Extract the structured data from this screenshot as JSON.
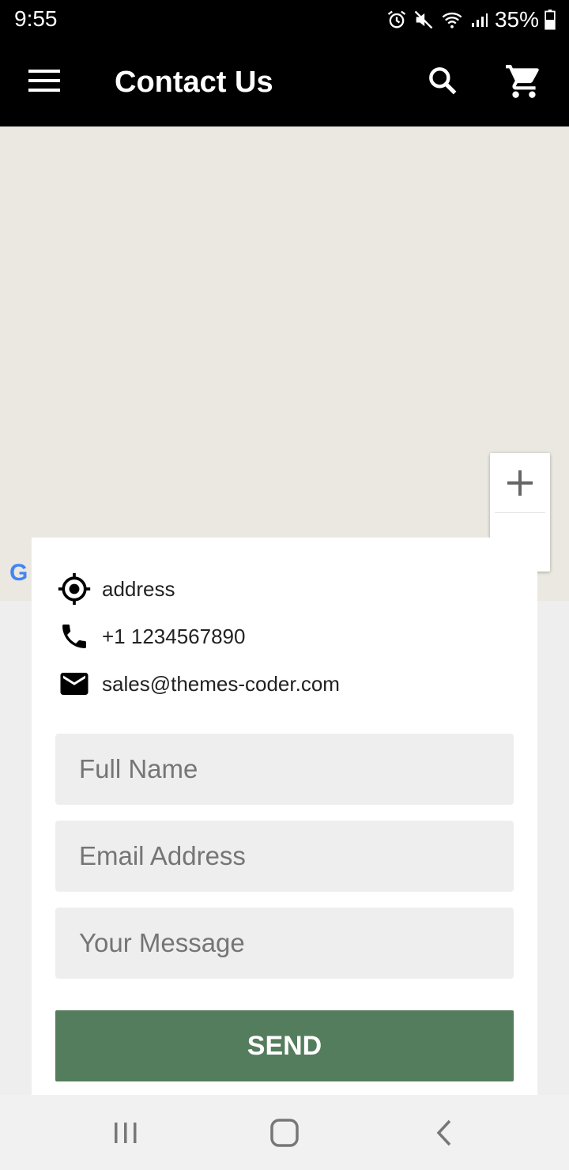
{
  "status_bar": {
    "time": "9:55",
    "battery": "35%",
    "icons": [
      "alarm-icon",
      "mute-icon",
      "wifi-icon",
      "signal-icon",
      "battery-icon"
    ]
  },
  "app_bar": {
    "title": "Contact Us",
    "icons": [
      "menu-icon",
      "search-icon",
      "cart-icon"
    ]
  },
  "map": {
    "zoom_in_label": "+",
    "logo_text": "G"
  },
  "contact_info": {
    "address": "address",
    "phone": "+1 1234567890",
    "email": "sales@themes-coder.com",
    "icons": [
      "location-icon",
      "phone-icon",
      "email-icon"
    ]
  },
  "form": {
    "full_name_placeholder": "Full Name",
    "email_placeholder": "Email Address",
    "message_placeholder": "Your Message",
    "send_label": "SEND"
  },
  "nav_bar": {
    "icons": [
      "recents-icon",
      "home-icon",
      "back-icon"
    ]
  },
  "colors": {
    "bar_background": "#000000",
    "map_background": "#ebe8e1",
    "field_background": "#eeeeee",
    "send_button": "#537d5c"
  }
}
